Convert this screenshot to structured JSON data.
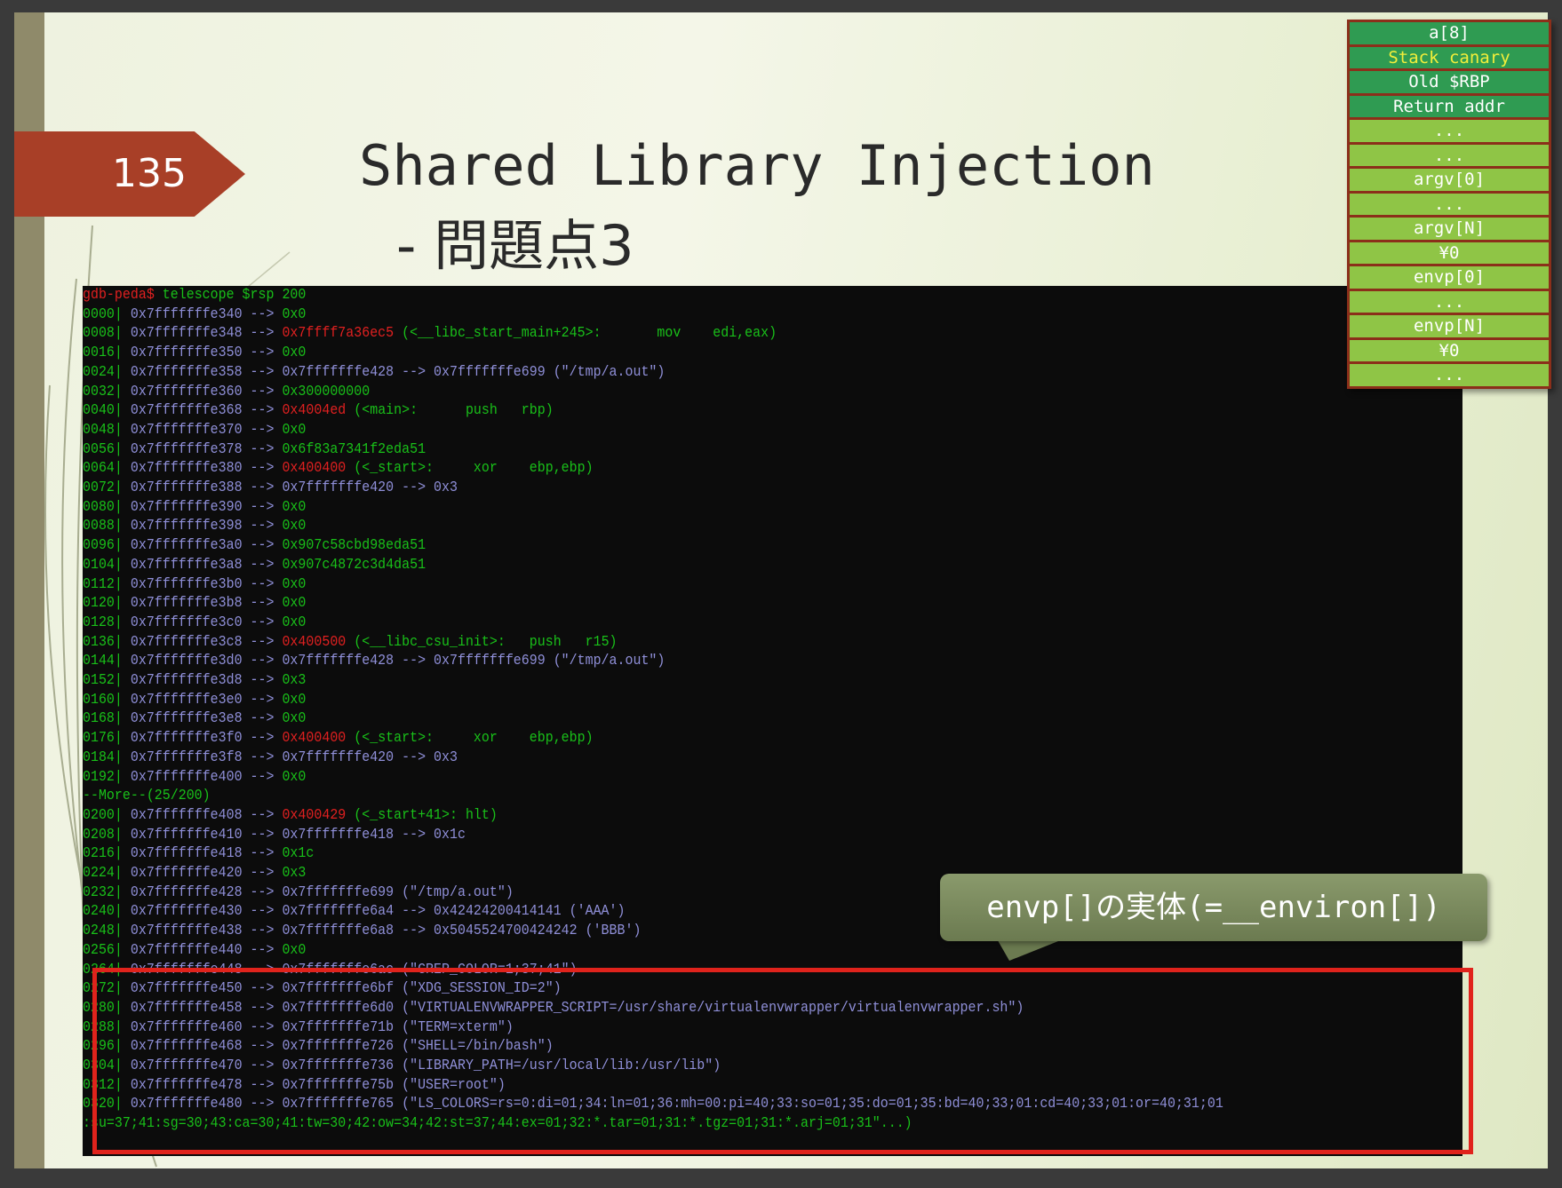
{
  "slide": {
    "number": "135",
    "title_line1": "Shared Library Injection",
    "title_line2": "- 問題点3"
  },
  "terminal": {
    "prompt": "gdb-peda$",
    "command": " telescope $rsp 200",
    "more_prompt": "--More--(25/200)",
    "lines_before_more": [
      {
        "idx": "0000",
        "addr": "0x7fffffffe340",
        "arrow": " --> ",
        "val": "0x0",
        "val_style": "plain",
        "rest": ""
      },
      {
        "idx": "0008",
        "addr": "0x7fffffffe348",
        "arrow": " --> ",
        "val": "0x7ffff7a36ec5",
        "val_style": "code",
        "rest": " (<__libc_start_main+245>:       mov    edi,eax)"
      },
      {
        "idx": "0016",
        "addr": "0x7fffffffe350",
        "arrow": " --> ",
        "val": "0x0",
        "val_style": "plain",
        "rest": ""
      },
      {
        "idx": "0024",
        "addr": "0x7fffffffe358",
        "arrow": " --> ",
        "val": "0x7fffffffe428",
        "val_style": "ptr",
        "rest": " --> 0x7fffffffe699 (\"/tmp/a.out\")"
      },
      {
        "idx": "0032",
        "addr": "0x7fffffffe360",
        "arrow": " --> ",
        "val": "0x300000000",
        "val_style": "plain",
        "rest": ""
      },
      {
        "idx": "0040",
        "addr": "0x7fffffffe368",
        "arrow": " --> ",
        "val": "0x4004ed",
        "val_style": "code",
        "rest": " (<main>:      push   rbp)"
      },
      {
        "idx": "0048",
        "addr": "0x7fffffffe370",
        "arrow": " --> ",
        "val": "0x0",
        "val_style": "plain",
        "rest": ""
      },
      {
        "idx": "0056",
        "addr": "0x7fffffffe378",
        "arrow": " --> ",
        "val": "0x6f83a7341f2eda51",
        "val_style": "plain",
        "rest": ""
      },
      {
        "idx": "0064",
        "addr": "0x7fffffffe380",
        "arrow": " --> ",
        "val": "0x400400",
        "val_style": "code",
        "rest": " (<_start>:     xor    ebp,ebp)"
      },
      {
        "idx": "0072",
        "addr": "0x7fffffffe388",
        "arrow": " --> ",
        "val": "0x7fffffffe420",
        "val_style": "ptr",
        "rest": " --> 0x3"
      },
      {
        "idx": "0080",
        "addr": "0x7fffffffe390",
        "arrow": " --> ",
        "val": "0x0",
        "val_style": "plain",
        "rest": ""
      },
      {
        "idx": "0088",
        "addr": "0x7fffffffe398",
        "arrow": " --> ",
        "val": "0x0",
        "val_style": "plain",
        "rest": ""
      },
      {
        "idx": "0096",
        "addr": "0x7fffffffe3a0",
        "arrow": " --> ",
        "val": "0x907c58cbd98eda51",
        "val_style": "plain",
        "rest": ""
      },
      {
        "idx": "0104",
        "addr": "0x7fffffffe3a8",
        "arrow": " --> ",
        "val": "0x907c4872c3d4da51",
        "val_style": "plain",
        "rest": ""
      },
      {
        "idx": "0112",
        "addr": "0x7fffffffe3b0",
        "arrow": " --> ",
        "val": "0x0",
        "val_style": "plain",
        "rest": ""
      },
      {
        "idx": "0120",
        "addr": "0x7fffffffe3b8",
        "arrow": " --> ",
        "val": "0x0",
        "val_style": "plain",
        "rest": ""
      },
      {
        "idx": "0128",
        "addr": "0x7fffffffe3c0",
        "arrow": " --> ",
        "val": "0x0",
        "val_style": "plain",
        "rest": ""
      },
      {
        "idx": "0136",
        "addr": "0x7fffffffe3c8",
        "arrow": " --> ",
        "val": "0x400500",
        "val_style": "code",
        "rest": " (<__libc_csu_init>:   push   r15)"
      },
      {
        "idx": "0144",
        "addr": "0x7fffffffe3d0",
        "arrow": " --> ",
        "val": "0x7fffffffe428",
        "val_style": "ptr",
        "rest": " --> 0x7fffffffe699 (\"/tmp/a.out\")"
      },
      {
        "idx": "0152",
        "addr": "0x7fffffffe3d8",
        "arrow": " --> ",
        "val": "0x3",
        "val_style": "plain",
        "rest": ""
      },
      {
        "idx": "0160",
        "addr": "0x7fffffffe3e0",
        "arrow": " --> ",
        "val": "0x0",
        "val_style": "plain",
        "rest": ""
      },
      {
        "idx": "0168",
        "addr": "0x7fffffffe3e8",
        "arrow": " --> ",
        "val": "0x0",
        "val_style": "plain",
        "rest": ""
      },
      {
        "idx": "0176",
        "addr": "0x7fffffffe3f0",
        "arrow": " --> ",
        "val": "0x400400",
        "val_style": "code",
        "rest": " (<_start>:     xor    ebp,ebp)"
      },
      {
        "idx": "0184",
        "addr": "0x7fffffffe3f8",
        "arrow": " --> ",
        "val": "0x7fffffffe420",
        "val_style": "ptr",
        "rest": " --> 0x3"
      },
      {
        "idx": "0192",
        "addr": "0x7fffffffe400",
        "arrow": " --> ",
        "val": "0x0",
        "val_style": "plain",
        "rest": ""
      }
    ],
    "lines_after_more": [
      {
        "idx": "0200",
        "addr": "0x7fffffffe408",
        "arrow": " --> ",
        "val": "0x400429",
        "val_style": "code",
        "rest": " (<_start+41>: hlt)"
      },
      {
        "idx": "0208",
        "addr": "0x7fffffffe410",
        "arrow": " --> ",
        "val": "0x7fffffffe418",
        "val_style": "ptr",
        "rest": " --> 0x1c"
      },
      {
        "idx": "0216",
        "addr": "0x7fffffffe418",
        "arrow": " --> ",
        "val": "0x1c",
        "val_style": "plain",
        "rest": ""
      },
      {
        "idx": "0224",
        "addr": "0x7fffffffe420",
        "arrow": " --> ",
        "val": "0x3",
        "val_style": "plain",
        "rest": ""
      },
      {
        "idx": "0232",
        "addr": "0x7fffffffe428",
        "arrow": " --> ",
        "val": "0x7fffffffe699",
        "val_style": "ptr",
        "rest": " (\"/tmp/a.out\")"
      },
      {
        "idx": "0240",
        "addr": "0x7fffffffe430",
        "arrow": " --> ",
        "val": "0x7fffffffe6a4",
        "val_style": "ptr",
        "rest": " --> 0x42424200414141 ('AAA')"
      },
      {
        "idx": "0248",
        "addr": "0x7fffffffe438",
        "arrow": " --> ",
        "val": "0x7fffffffe6a8",
        "val_style": "ptr",
        "rest": " --> 0x5045524700424242 ('BBB')"
      },
      {
        "idx": "0256",
        "addr": "0x7fffffffe440",
        "arrow": " --> ",
        "val": "0x0",
        "val_style": "plain",
        "rest": ""
      }
    ],
    "env_lines": [
      {
        "idx": "0264",
        "addr": "0x7fffffffe448",
        "arrow": " --> ",
        "val": "0x7fffffffe6ac",
        "val_style": "ptr",
        "rest": " (\"GREP_COLOR=1;37;41\")"
      },
      {
        "idx": "0272",
        "addr": "0x7fffffffe450",
        "arrow": " --> ",
        "val": "0x7fffffffe6bf",
        "val_style": "ptr",
        "rest": " (\"XDG_SESSION_ID=2\")"
      },
      {
        "idx": "0280",
        "addr": "0x7fffffffe458",
        "arrow": " --> ",
        "val": "0x7fffffffe6d0",
        "val_style": "ptr",
        "rest": " (\"VIRTUALENVWRAPPER_SCRIPT=/usr/share/virtualenvwrapper/virtualenvwrapper.sh\")"
      },
      {
        "idx": "0288",
        "addr": "0x7fffffffe460",
        "arrow": " --> ",
        "val": "0x7fffffffe71b",
        "val_style": "ptr",
        "rest": " (\"TERM=xterm\")"
      },
      {
        "idx": "0296",
        "addr": "0x7fffffffe468",
        "arrow": " --> ",
        "val": "0x7fffffffe726",
        "val_style": "ptr",
        "rest": " (\"SHELL=/bin/bash\")"
      },
      {
        "idx": "0304",
        "addr": "0x7fffffffe470",
        "arrow": " --> ",
        "val": "0x7fffffffe736",
        "val_style": "ptr",
        "rest": " (\"LIBRARY_PATH=/usr/local/lib:/usr/lib\")"
      },
      {
        "idx": "0312",
        "addr": "0x7fffffffe478",
        "arrow": " --> ",
        "val": "0x7fffffffe75b",
        "val_style": "ptr",
        "rest": " (\"USER=root\")"
      },
      {
        "idx": "0320",
        "addr": "0x7fffffffe480",
        "arrow": " --> ",
        "val": "0x7fffffffe765",
        "val_style": "ptr",
        "rest": " (\"LS_COLORS=rs=0:di=01;34:ln=01;36:mh=00:pi=40;33:so=01;35:do=01;35:bd=40;33;01:cd=40;33;01:or=40;31;01"
      }
    ],
    "env_continuation": ":su=37;41:sg=30;43:ca=30;41:tw=30;42:ow=34;42:st=37;44:ex=01;32:*.tar=01;31:*.tgz=01;31:*.arj=01;31\"...)"
  },
  "callout": {
    "text": "envp[]の実体(=__environ[])"
  },
  "stack": [
    {
      "label": "a[8]",
      "style": "dark"
    },
    {
      "label": "Stack canary",
      "style": "dark-canary"
    },
    {
      "label": "Old $RBP",
      "style": "dark"
    },
    {
      "label": "Return addr",
      "style": "dark"
    },
    {
      "label": "...",
      "style": "light"
    },
    {
      "label": "...",
      "style": "light"
    },
    {
      "label": "argv[0]",
      "style": "light"
    },
    {
      "label": "...",
      "style": "light"
    },
    {
      "label": "argv[N]",
      "style": "light"
    },
    {
      "label": "¥0",
      "style": "light"
    },
    {
      "label": "envp[0]",
      "style": "light"
    },
    {
      "label": "...",
      "style": "light"
    },
    {
      "label": "envp[N]",
      "style": "light"
    },
    {
      "label": "¥0",
      "style": "light"
    },
    {
      "label": "...",
      "style": "light"
    }
  ],
  "colors": {
    "slide_number_tab": "#a83f27",
    "terminal_bg": "#0c0c0c",
    "term_green": "#19c019",
    "term_red": "#e02020",
    "term_blue": "#8f8fd8",
    "highlight_border": "#e0231c",
    "stack_dark": "#2f9b52",
    "stack_light": "#8fc546",
    "stack_border": "#8b2f1a"
  }
}
